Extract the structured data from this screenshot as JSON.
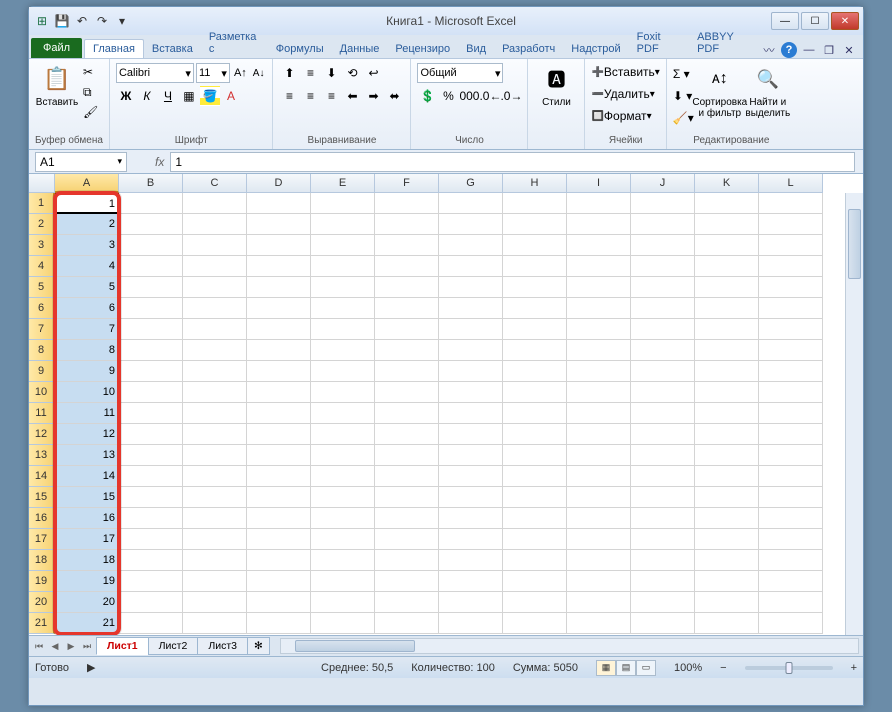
{
  "titlebar": {
    "title": "Книга1 - Microsoft Excel"
  },
  "tabs": {
    "file": "Файл",
    "items": [
      "Главная",
      "Вставка",
      "Разметка с",
      "Формулы",
      "Данные",
      "Рецензиро",
      "Вид",
      "Разработч",
      "Надстрой",
      "Foxit PDF",
      "ABBYY PDF"
    ],
    "activeIndex": 0
  },
  "ribbon": {
    "clipboard": {
      "paste": "Вставить",
      "label": "Буфер обмена"
    },
    "font": {
      "name": "Calibri",
      "size": "11",
      "label": "Шрифт"
    },
    "align": {
      "label": "Выравнивание"
    },
    "number": {
      "format": "Общий",
      "label": "Число"
    },
    "styles": {
      "btn": "Стили",
      "label": ""
    },
    "cells": {
      "insert": "Вставить",
      "delete": "Удалить",
      "format": "Формат",
      "label": "Ячейки"
    },
    "editing": {
      "sort": "Сортировка и фильтр",
      "find": "Найти и выделить",
      "label": "Редактирование"
    }
  },
  "formula": {
    "name": "A1",
    "fx": "fx",
    "value": "1"
  },
  "grid": {
    "cols": [
      "A",
      "B",
      "C",
      "D",
      "E",
      "F",
      "G",
      "H",
      "I",
      "J",
      "K",
      "L"
    ],
    "rows": [
      1,
      2,
      3,
      4,
      5,
      6,
      7,
      8,
      9,
      10,
      11,
      12,
      13,
      14,
      15,
      16,
      17,
      18,
      19,
      20,
      21
    ],
    "colA": [
      "1",
      "2",
      "3",
      "4",
      "5",
      "6",
      "7",
      "8",
      "9",
      "10",
      "11",
      "12",
      "13",
      "14",
      "15",
      "16",
      "17",
      "18",
      "19",
      "20",
      "21"
    ]
  },
  "sheets": {
    "items": [
      "Лист1",
      "Лист2",
      "Лист3"
    ],
    "activeIndex": 0
  },
  "status": {
    "ready": "Готово",
    "avg_lbl": "Среднее:",
    "avg": "50,5",
    "count_lbl": "Количество:",
    "count": "100",
    "sum_lbl": "Сумма:",
    "sum": "5050",
    "zoom": "100%"
  }
}
